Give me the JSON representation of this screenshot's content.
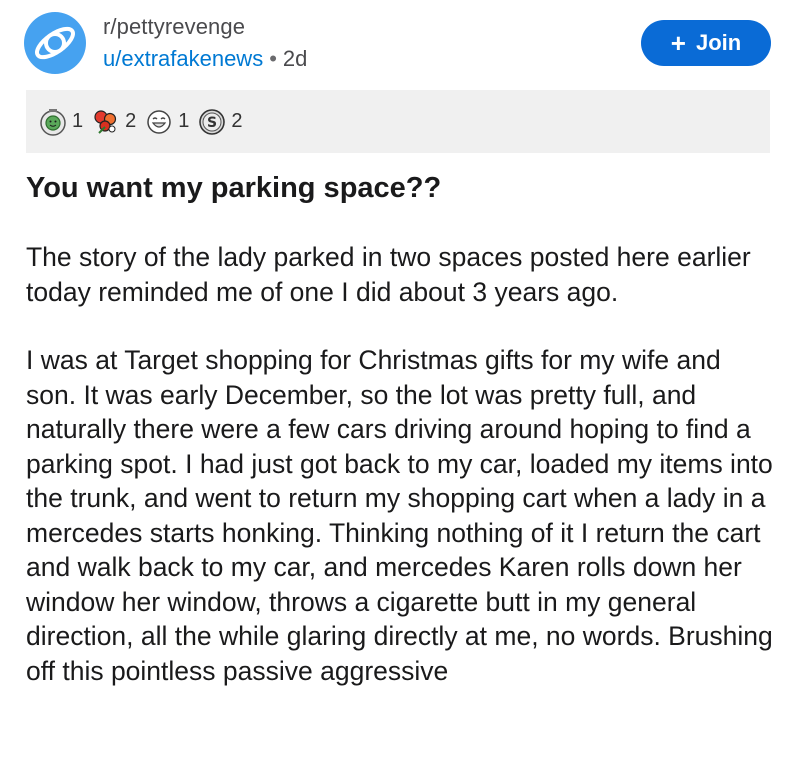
{
  "post": {
    "subreddit": "r/pettyrevenge",
    "author": "u/extrafakenews",
    "separator": "•",
    "age": "2d",
    "join_label": "Join",
    "join_icon": "plus-icon",
    "awards": [
      {
        "icon": "wholesome-award-icon",
        "count": "1"
      },
      {
        "icon": "bouquet-award-icon",
        "count": "2"
      },
      {
        "icon": "laughing-award-icon",
        "count": "1"
      },
      {
        "icon": "silver-award-icon",
        "count": "2"
      }
    ],
    "title": "You want my parking space??",
    "paragraphs": [
      "The story of the lady parked in two spaces posted here earlier today reminded me of one I did about 3 years ago.",
      "I was at Target shopping for Christmas gifts for my wife and son. It was early December, so the lot was pretty full, and naturally there were a few cars driving around hoping to find a parking spot. I had just got back to my car, loaded my items into the trunk, and went to return my shopping cart when a lady in a mercedes starts honking. Thinking nothing of it I return the cart and walk back to my car, and mercedes Karen rolls down her window her window, throws a cigarette butt in my general direction, all the while glaring directly at me, no words. Brushing off this pointless passive aggressive"
    ]
  },
  "colors": {
    "avatar_bg": "#46a2f0",
    "join_bg": "#0a6bd6",
    "username": "#0079d3",
    "awards_bg": "#f0f0f0"
  }
}
